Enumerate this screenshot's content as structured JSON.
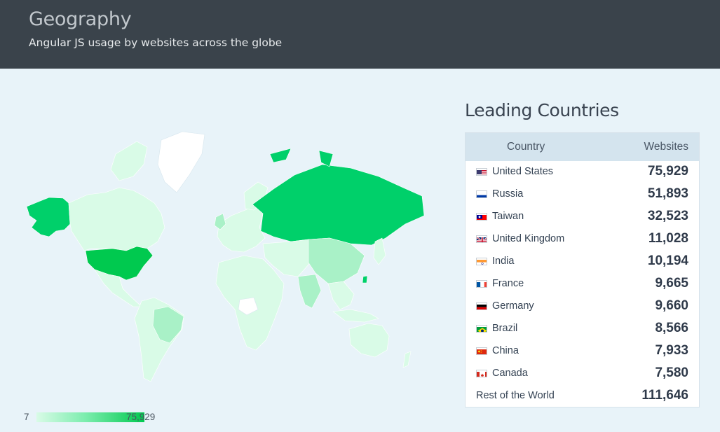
{
  "header": {
    "title": "Geography",
    "subtitle": "Angular JS usage by websites across the globe"
  },
  "legend": {
    "min": "7",
    "max": "75,929",
    "color_low": "#d9fbe7",
    "color_high": "#00c94f"
  },
  "panel": {
    "title": "Leading Countries",
    "col_country": "Country",
    "col_websites": "Websites",
    "rows": [
      {
        "country": "United States",
        "websites": "75,929",
        "flag": "us-flag-icon"
      },
      {
        "country": "Russia",
        "websites": "51,893",
        "flag": "ru-flag-icon"
      },
      {
        "country": "Taiwan",
        "websites": "32,523",
        "flag": "tw-flag-icon"
      },
      {
        "country": "United Kingdom",
        "websites": "11,028",
        "flag": "gb-flag-icon"
      },
      {
        "country": "India",
        "websites": "10,194",
        "flag": "in-flag-icon"
      },
      {
        "country": "France",
        "websites": "9,665",
        "flag": "fr-flag-icon"
      },
      {
        "country": "Germany",
        "websites": "9,660",
        "flag": "de-flag-icon"
      },
      {
        "country": "Brazil",
        "websites": "8,566",
        "flag": "br-flag-icon"
      },
      {
        "country": "China",
        "websites": "7,933",
        "flag": "cn-flag-icon"
      },
      {
        "country": "Canada",
        "websites": "7,580",
        "flag": "ca-flag-icon"
      }
    ],
    "rest": {
      "country": "Rest of the World",
      "websites": "111,646"
    }
  },
  "map_colors": {
    "ocean": "#e8f3f9",
    "no_data": "#ffffff",
    "low": "#d9fbe7",
    "mid": "#a9f1c7",
    "high": "#00d06a",
    "top": "#00c94f"
  }
}
